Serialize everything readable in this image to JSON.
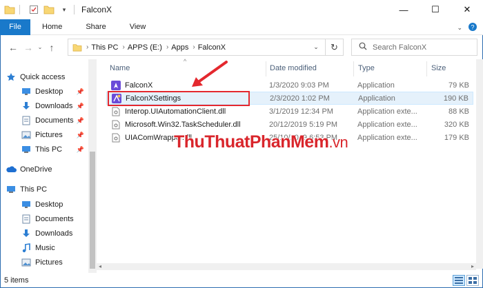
{
  "window": {
    "title": "FalconX",
    "min_label": "—",
    "max_label": "☐",
    "close_label": "✕"
  },
  "ribbon": {
    "file_label": "File",
    "tabs": [
      "Home",
      "Share",
      "View"
    ]
  },
  "address": {
    "crumbs": [
      "This PC",
      "APPS (E:)",
      "Apps",
      "FalconX"
    ]
  },
  "search": {
    "placeholder": "Search FalconX"
  },
  "navpane": {
    "quick_access": "Quick access",
    "quick_items": [
      "Desktop",
      "Downloads",
      "Documents",
      "Pictures",
      "This PC"
    ],
    "onedrive": "OneDrive",
    "this_pc": "This PC",
    "pc_items": [
      "Desktop",
      "Documents",
      "Downloads",
      "Music",
      "Pictures"
    ]
  },
  "columns": {
    "name": "Name",
    "date": "Date modified",
    "type": "Type",
    "size": "Size"
  },
  "files": [
    {
      "name": "FalconX",
      "date": "1/3/2020 9:03 PM",
      "type": "Application",
      "size": "79 KB",
      "icon": "falcon-app-icon"
    },
    {
      "name": "FalconXSettings",
      "date": "2/3/2020 1:02 PM",
      "type": "Application",
      "size": "190 KB",
      "icon": "falcon-settings-icon"
    },
    {
      "name": "Interop.UIAutomationClient.dll",
      "date": "3/1/2019 12:34 PM",
      "type": "Application exte...",
      "size": "88 KB",
      "icon": "dll-icon"
    },
    {
      "name": "Microsoft.Win32.TaskScheduler.dll",
      "date": "20/12/2019 5:19 PM",
      "type": "Application exte...",
      "size": "320 KB",
      "icon": "dll-icon"
    },
    {
      "name": "UIAComWrapper.dll",
      "date": "25/10/2019 6:53 PM",
      "type": "Application exte...",
      "size": "179 KB",
      "icon": "dll-icon"
    }
  ],
  "watermark": {
    "main": "ThuThuatPhanMem",
    "suffix": ".vn"
  },
  "status": {
    "count": "5 items"
  },
  "colors": {
    "accent": "#1979ca",
    "highlight": "#e4282e",
    "watermark": "#d9262c"
  }
}
